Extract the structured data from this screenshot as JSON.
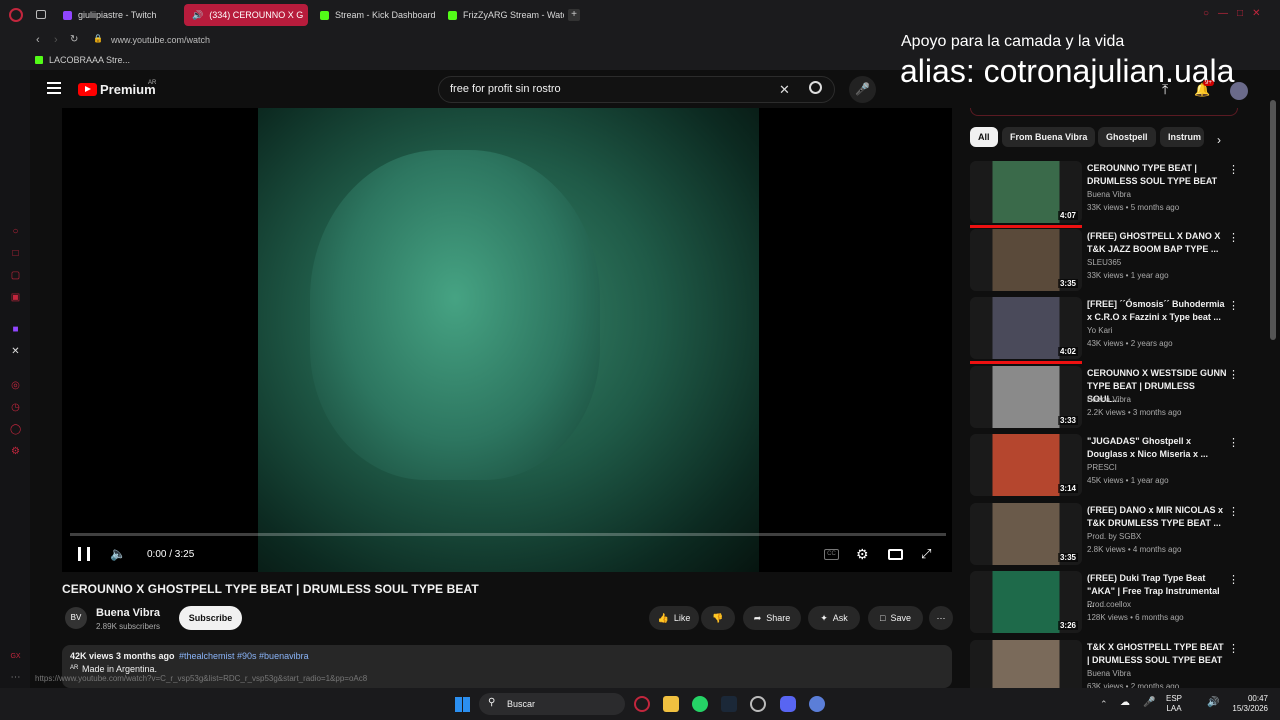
{
  "browser": {
    "tabs": [
      {
        "label": "giuliipiastre - Twitch",
        "color": "#9146ff"
      },
      {
        "label": "(334) CEROUNNO X G",
        "color": "#ffffff"
      },
      {
        "label": "Stream - Kick Dashboard",
        "color": "#53fc18"
      },
      {
        "label": "FrizZyARG Stream - Watch",
        "color": "#53fc18"
      }
    ],
    "url": "www.youtube.com/watch",
    "bookmark": "LACOBRAAA Stre...",
    "status_url": "https://www.youtube.com/watch?v=C_r_vsp53g&list=RDC_r_vsp53g&start_radio=1&pp=oAc8"
  },
  "overlay": {
    "line1": "Apoyo para la camada y la vida",
    "line2": "alias: cotronajulian.uala"
  },
  "yt": {
    "logo": "Premium",
    "region": "AR",
    "search": "free for profit sin rostro",
    "time": "0:00 / 3:25",
    "title": "CEROUNNO X GHOSTPELL TYPE BEAT | DRUMLESS SOUL TYPE BEAT",
    "channel": "Buena Vibra",
    "subs": "2.89K subscribers",
    "subscribe": "Subscribe",
    "actions": {
      "like": "Like",
      "share": "Share",
      "ask": "Ask",
      "save": "Save"
    },
    "desc_line1": "42K views  3 months ago",
    "tags": "#thealchemist #90s #buenavibra",
    "desc_line2": "Made in Argentina.",
    "chips": [
      "All",
      "From Buena Vibra",
      "Ghostpell",
      "Instrum"
    ],
    "recs": [
      {
        "title": "CEROUNNO TYPE BEAT | DRUMLESS SOUL TYPE BEAT",
        "channel": "Buena Vibra",
        "meta": "33K views • 5 months ago",
        "dur": "4:07"
      },
      {
        "title": "(FREE) GHOSTPELL X DANO X T&K JAZZ BOOM BAP TYPE ...",
        "channel": "SLEU365",
        "meta": "33K views • 1 year ago",
        "dur": "3:35"
      },
      {
        "title": "[FREE] ´´Ósmosis´´ Buhodermia x C.R.O x Fazzini x Type beat ...",
        "channel": "Yo Kari",
        "meta": "43K views • 2 years ago",
        "dur": "4:02"
      },
      {
        "title": "CEROUNNO X WESTSIDE GUNN TYPE BEAT | DRUMLESS SOUL...",
        "channel": "Buena Vibra",
        "meta": "2.2K views • 3 months ago",
        "dur": "3:33"
      },
      {
        "title": "\"JUGADAS\" Ghostpell x Douglass x Nico Miseria x ...",
        "channel": "PRESCI",
        "meta": "45K views • 1 year ago",
        "dur": "3:14"
      },
      {
        "title": "(FREE) DANO x MIR NICOLAS x T&K DRUMLESS TYPE BEAT ...",
        "channel": "Prod. by SGBX",
        "meta": "2.8K views • 4 months ago",
        "dur": "3:35"
      },
      {
        "title": "(FREE) Duki Trap Type Beat \"AKA\" | Free Trap Instrumental ...",
        "channel": "Prod.coellox",
        "meta": "128K views • 6 months ago",
        "dur": "3:26"
      },
      {
        "title": "T&K X GHOSTPELL TYPE BEAT | DRUMLESS SOUL TYPE BEAT",
        "channel": "Buena Vibra",
        "meta": "63K views • 2 months ago",
        "dur": ""
      }
    ],
    "notif": "9+"
  },
  "taskbar": {
    "search": "Buscar",
    "lang": "ESP",
    "lang2": "LAA",
    "time": "00:47",
    "date": "15/3/2026"
  }
}
